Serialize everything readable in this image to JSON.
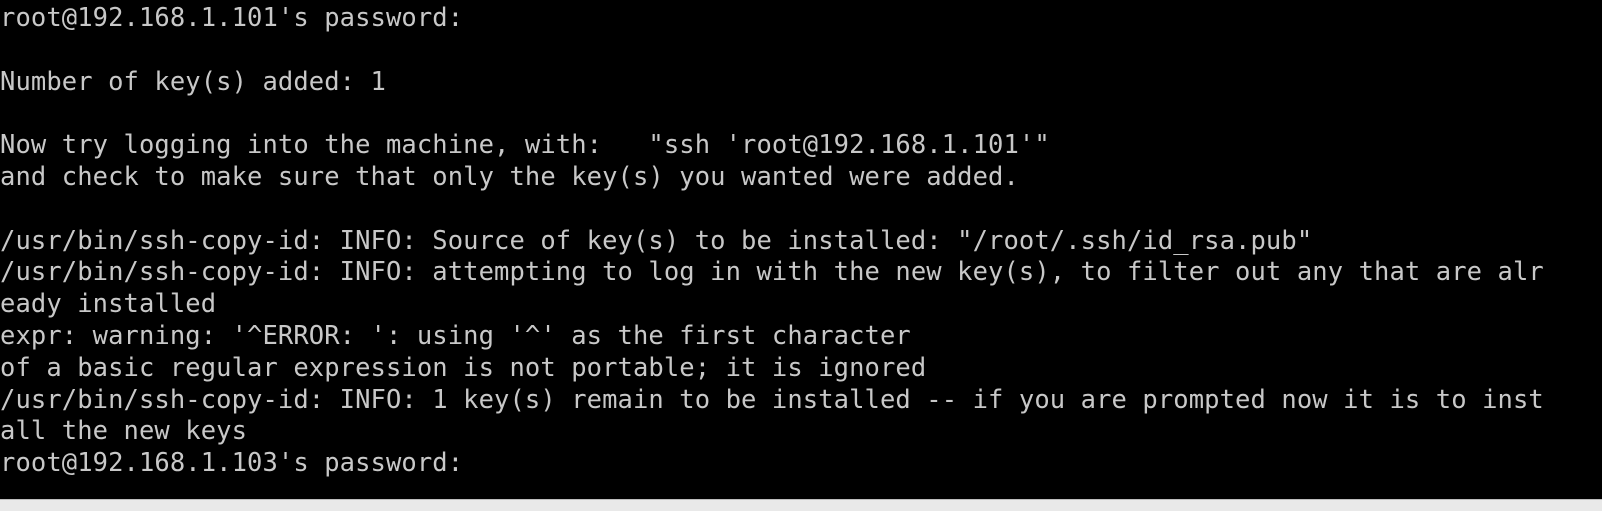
{
  "terminal": {
    "lines": [
      "root@192.168.1.101's password:",
      "",
      "Number of key(s) added: 1",
      "",
      "Now try logging into the machine, with:   \"ssh 'root@192.168.1.101'\"",
      "and check to make sure that only the key(s) you wanted were added.",
      "",
      "/usr/bin/ssh-copy-id: INFO: Source of key(s) to be installed: \"/root/.ssh/id_rsa.pub\"",
      "/usr/bin/ssh-copy-id: INFO: attempting to log in with the new key(s), to filter out any that are alr",
      "eady installed",
      "expr: warning: '^ERROR: ': using '^' as the first character",
      "of a basic regular expression is not portable; it is ignored",
      "/usr/bin/ssh-copy-id: INFO: 1 key(s) remain to be installed -- if you are prompted now it is to inst",
      "all the new keys",
      "root@192.168.1.103's password:"
    ]
  },
  "colors": {
    "background": "#000000",
    "foreground": "#c8c8c8"
  }
}
